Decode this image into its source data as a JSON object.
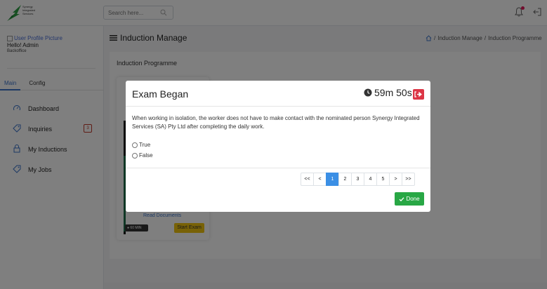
{
  "app": {
    "logo_text": [
      "Synergy",
      "Integrated",
      "Services"
    ],
    "search_placeholder": "Search here..."
  },
  "sidebar": {
    "profile_picture_alt": "User Profile Picture",
    "greeting": "Hello! Admin",
    "role": "Backoffice",
    "tabs": [
      {
        "label": "Main",
        "active": true
      },
      {
        "label": "Config",
        "active": false
      }
    ],
    "items": [
      {
        "label": "Dashboard",
        "icon": "gauge-icon"
      },
      {
        "label": "Inquiries",
        "icon": "tag-icon",
        "badge": "3"
      },
      {
        "label": "My Inductions",
        "icon": "lock-icon"
      },
      {
        "label": "My Jobs",
        "icon": "tag-icon"
      }
    ]
  },
  "header": {
    "title": "Induction Manage",
    "breadcrumb": [
      "Induction Manage",
      "Induction Programme"
    ]
  },
  "panel": {
    "title": "Induction Programme",
    "card": {
      "read_documents": "Read Documents",
      "duration": "60 MIN",
      "start_label": "Start Exam"
    }
  },
  "modal": {
    "title": "Exam Began",
    "timer": "59m 50s",
    "question": "When working in isolation, the worker does not have to make contact with the nominated person Synergy Integrated Services (SA) Pty Ltd after completing the daily work.",
    "options": [
      "True",
      "False"
    ],
    "pagination": {
      "first": "<<",
      "prev": "<",
      "pages": [
        "1",
        "2",
        "3",
        "4",
        "5"
      ],
      "current": "1",
      "next": ">",
      "last": ">>"
    },
    "done_label": "Done"
  },
  "colors": {
    "primary": "#3b8fe5",
    "success": "#28a745",
    "danger": "#dc3545",
    "warning": "#f1c40f",
    "accent_pink": "#e2195b"
  }
}
